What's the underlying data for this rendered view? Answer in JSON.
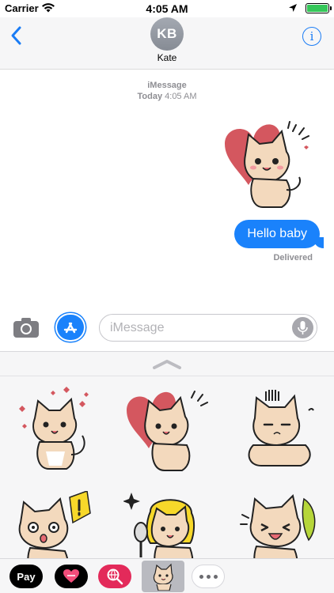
{
  "status_bar": {
    "carrier": "Carrier",
    "time": "4:05 AM",
    "battery_level": 1.0,
    "icons": [
      "wifi-icon",
      "location-icon",
      "battery-icon"
    ]
  },
  "header": {
    "avatar_initials": "KB",
    "contact_name": "Kate",
    "icons": [
      "back-chevron-icon",
      "info-icon"
    ]
  },
  "conversation": {
    "service": "iMessage",
    "day": "Today",
    "time": "4:05 AM",
    "messages": [
      {
        "type": "sticker",
        "sticker": "kitten-heart-dancing"
      },
      {
        "type": "text",
        "text": "Hello baby",
        "direction": "sent"
      }
    ],
    "status": "Delivered"
  },
  "composer": {
    "placeholder": "iMessage",
    "icons": [
      "camera-icon",
      "app-store-icon",
      "microphone-icon"
    ]
  },
  "sticker_drawer": {
    "stickers": [
      "kitten-hearts-sticker",
      "kitten-heart-dancing-sticker",
      "kitten-sad-sticker",
      "kitten-surprised-sticker",
      "kitten-mirror-sticker",
      "kitten-laughing-sticker"
    ]
  },
  "app_strip": {
    "apple_pay_label": "Pay",
    "apps": [
      "apple-pay-icon",
      "digital-touch-icon",
      "image-search-icon",
      "kitten-sticker-app-icon",
      "more-apps-icon"
    ]
  },
  "colors": {
    "accent": "#1a82fb",
    "bubble_sent": "#1a82fb",
    "kitten_fur": "#f3d9bd",
    "heart": "#d4575f",
    "avatar_bg": "#9a9fa8"
  }
}
